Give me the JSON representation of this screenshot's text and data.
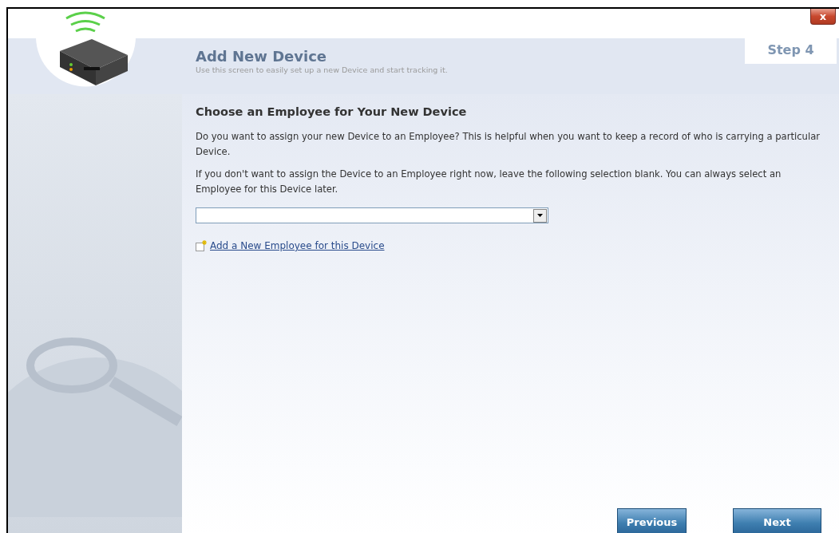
{
  "window": {
    "close_label": "x"
  },
  "header": {
    "title": "Add New Device",
    "subtitle": "Use this screen to easily set up a new Device and start tracking it.",
    "step": "Step 4"
  },
  "section": {
    "heading": "Choose an Employee for Your New Device",
    "paragraphs": [
      "Do you want to assign your new Device to an Employee? This is helpful when you want to keep a record of who is carrying a particular Device.",
      "If you don't want to assign the Device to an Employee right now, leave the following selection blank. You can always select an Employee for this Device later."
    ],
    "add_link": "Add a New Employee for this Device"
  },
  "buttons": [
    {
      "label": "Previous",
      "kind": "previous"
    },
    {
      "label": "Next",
      "kind": "next"
    }
  ]
}
